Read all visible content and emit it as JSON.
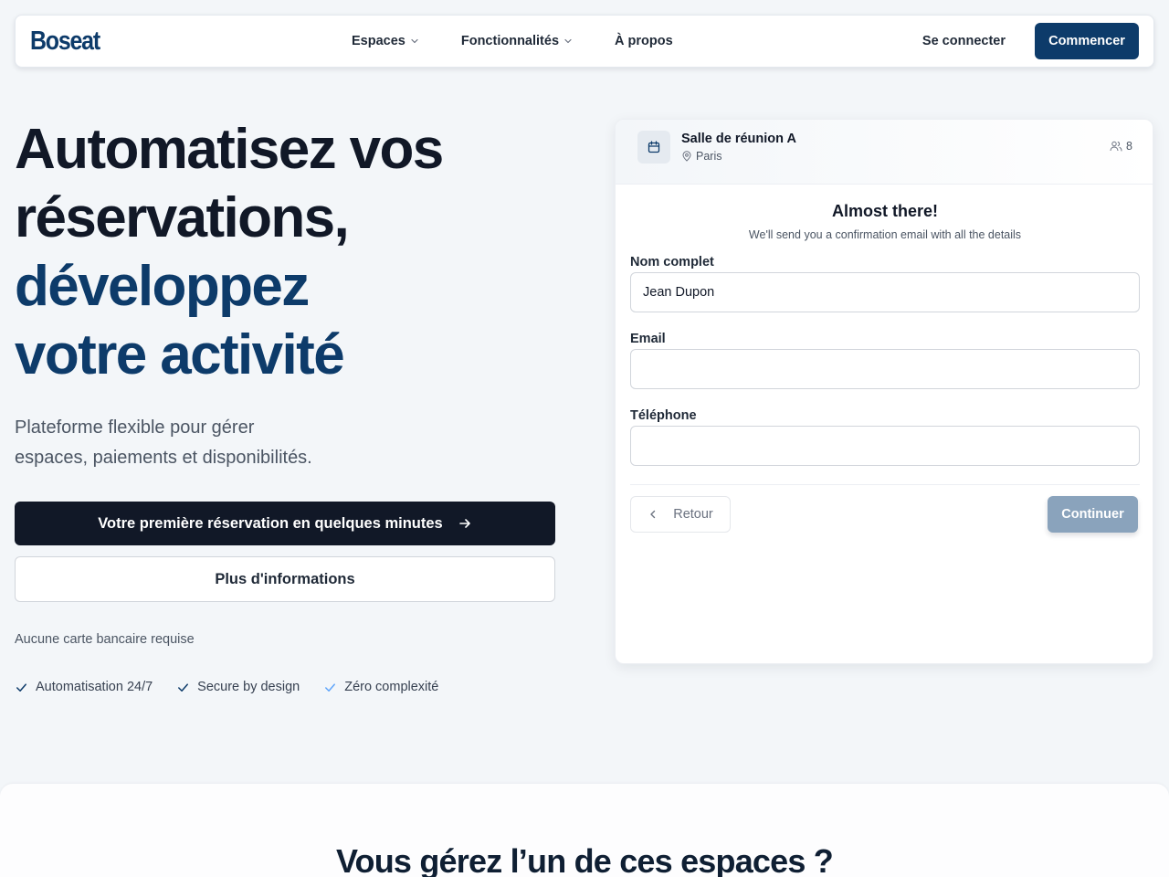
{
  "nav": {
    "logo": "Boseat",
    "links": [
      {
        "label": "Espaces",
        "dropdown": true
      },
      {
        "label": "Fonctionnalités",
        "dropdown": true
      },
      {
        "label": "À propos",
        "dropdown": false
      }
    ],
    "login": "Se connecter",
    "cta": "Commencer"
  },
  "hero": {
    "title_line1": "Automatisez vos",
    "title_line2": "réservations,",
    "title_line3": "développez",
    "title_line4": "votre activité",
    "subtitle_line1": "Plateforme flexible pour gérer",
    "subtitle_line2": "espaces, paiements et disponibilités.",
    "primary_cta": "Votre première réservation en quelques minutes",
    "secondary_cta": "Plus d'informations",
    "note": "Aucune carte bancaire requise",
    "features": [
      "Automatisation 24/7",
      "Secure by design",
      "Zéro complexité"
    ]
  },
  "booking": {
    "room_name": "Salle de réunion A",
    "location": "Paris",
    "capacity": "8",
    "title": "Almost there!",
    "subtitle": "We'll send you a confirmation email with all the details",
    "fields": {
      "name": {
        "label": "Nom complet",
        "value": "Jean Dupon"
      },
      "email": {
        "label": "Email",
        "value": ""
      },
      "phone": {
        "label": "Téléphone",
        "value": ""
      }
    },
    "back": "Retour",
    "continue": "Continuer"
  },
  "next_section": {
    "title": "Vous gérez l’un de ces espaces ?"
  },
  "colors": {
    "brand": "#0d3b6a",
    "dark": "#111827",
    "background": "#f3f6f9",
    "continue_disabled": "#8aa3bc",
    "check_muted": "#60a5fa"
  },
  "icons": {
    "nav_dropdown": "chevron-down-icon",
    "primary_cta": "arrow-right-icon",
    "feature": "check-icon",
    "room": "calendar-icon",
    "location": "map-pin-icon",
    "capacity": "users-icon",
    "back": "chevron-left-icon"
  }
}
